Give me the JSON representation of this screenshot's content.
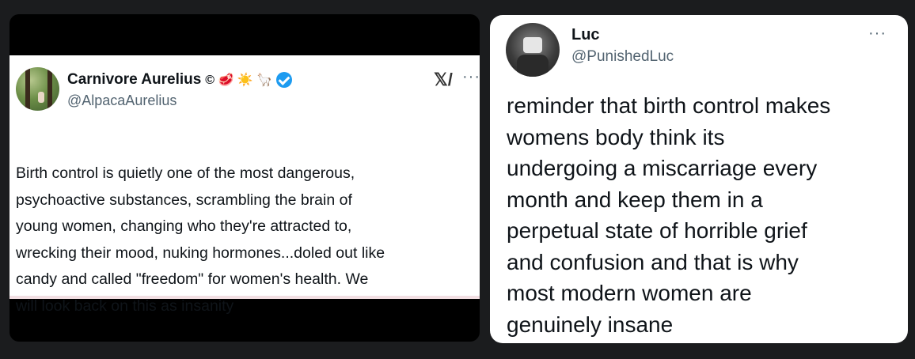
{
  "left_tweet": {
    "display_name": "Carnivore Aurelius",
    "name_emojis": "© 🥩 ☀️ 🦙",
    "handle": "@AlpacaAurelius",
    "grok_icon": "grok-icon",
    "more_label": "···",
    "body_lines": [
      "Birth control is quietly one of the most dangerous,",
      "psychoactive substances, scrambling the brain of",
      "young women, changing who they're attracted to,",
      "wrecking their mood, nuking hormones...doled out like",
      "candy and called \"freedom\" for women's health. We",
      "will look back on this as insanity"
    ]
  },
  "right_tweet": {
    "display_name": "Luc",
    "handle": "@PunishedLuc",
    "more_label": "···",
    "body_lines": [
      "reminder that birth control makes",
      "womens body think its",
      "undergoing a miscarriage every",
      "month and keep them in a",
      "perpetual state of horrible grief",
      "and confusion and that is why",
      "most modern women are",
      "genuinely insane"
    ]
  },
  "colors": {
    "background": "#1b1c1e",
    "verified": "#1d9bf0",
    "text": "#0f1419",
    "muted": "#536471"
  }
}
